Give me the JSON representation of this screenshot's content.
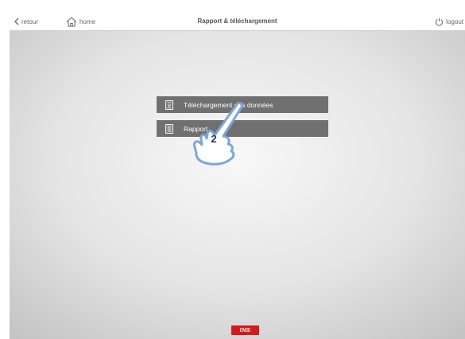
{
  "header": {
    "back_label": "retour",
    "home_label": "home",
    "title": "Rapport & téléchargement",
    "logout_label": "logout",
    "icons": {
      "back": "chevron-left-icon",
      "home": "home-icon",
      "logout": "power-icon"
    }
  },
  "menu": {
    "items": [
      {
        "label": "Téléchargement des données",
        "icon": "download-document-icon"
      },
      {
        "label": "Rapport",
        "icon": "report-document-icon"
      }
    ]
  },
  "tutorial": {
    "step_number": "2",
    "pointer_icon": "pointing-hand-icon"
  },
  "footer": {
    "logo_text": "IME"
  },
  "colors": {
    "menu_bg": "#707070",
    "logo_red": "#d8191c",
    "header_bg": "#ffffff",
    "step_text": "#1c2f5e"
  }
}
